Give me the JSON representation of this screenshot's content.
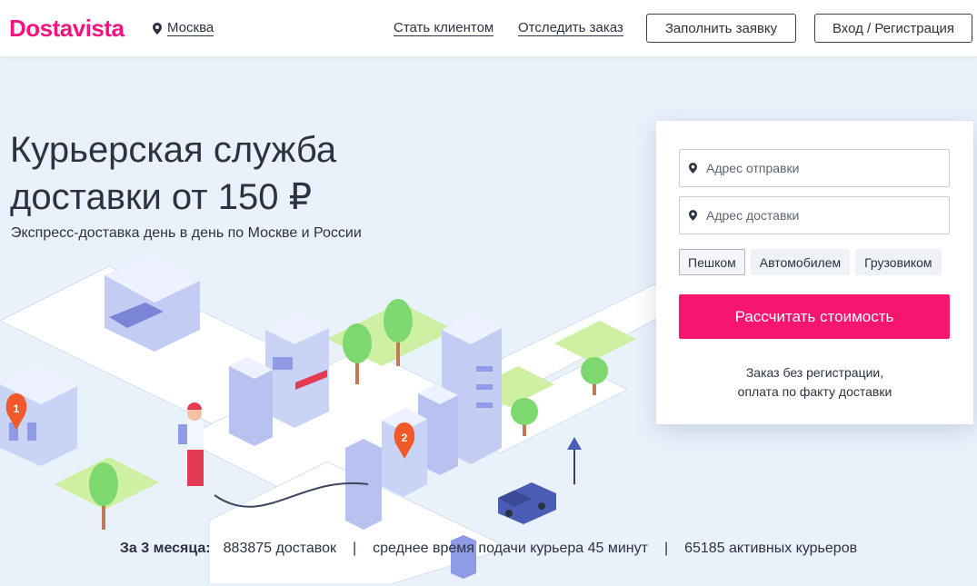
{
  "header": {
    "logo": "Dostavista",
    "city": "Москва",
    "nav": {
      "become_client": "Стать клиентом",
      "track_order": "Отследить заказ"
    },
    "buttons": {
      "apply": "Заполнить заявку",
      "login": "Вход / Регистрация"
    }
  },
  "hero": {
    "title": "Курьерская служба доставки от 150 ₽",
    "subtitle": "Экспресс-доставка день в день по Москве и России",
    "markers": [
      "1",
      "2"
    ]
  },
  "form": {
    "from_placeholder": "Адрес отправки",
    "to_placeholder": "Адрес доставки",
    "modes": [
      "Пешком",
      "Автомобилем",
      "Грузовиком"
    ],
    "active_mode": "Пешком",
    "calc_label": "Рассчитать стоимость",
    "note_line1": "Заказ без регистрации,",
    "note_line2": "оплата по факту доставки"
  },
  "stats": {
    "label": "За 3 месяца:",
    "deliveries": "883875 доставок",
    "pickup_time": "среднее время подачи курьера 45 минут",
    "couriers": "65185 активных курьеров",
    "separator": "|"
  },
  "colors": {
    "brand": "#f0157f",
    "button": "#f7156f",
    "hero_bg": "#e9f1fb"
  }
}
